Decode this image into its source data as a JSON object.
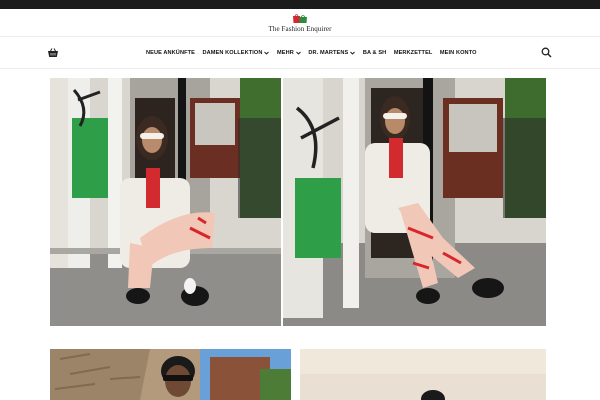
{
  "site": {
    "name": "The Fashion Enquirer"
  },
  "nav": {
    "items": [
      {
        "label": "NEUE ANKÜNFTE",
        "dropdown": false
      },
      {
        "label": "DAMEN KOLLEKTION",
        "dropdown": true
      },
      {
        "label": "MEHR",
        "dropdown": true
      },
      {
        "label": "DR. MARTENS",
        "dropdown": true
      },
      {
        "label": "BA & SH",
        "dropdown": false
      },
      {
        "label": "MERKZETTEL",
        "dropdown": false
      },
      {
        "label": "MEIN KONTO",
        "dropdown": false
      }
    ],
    "cart_icon": "cart-icon",
    "search_icon": "search-icon"
  },
  "colors": {
    "topbar": "#1b1b1b",
    "logo_red": "#d7262e",
    "logo_green": "#2e8b3d"
  }
}
